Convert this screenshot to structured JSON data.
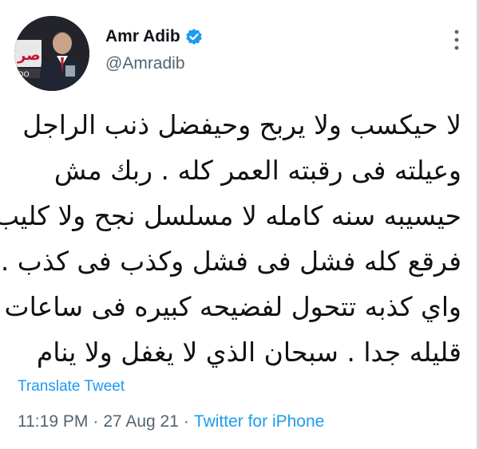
{
  "author": {
    "display_name": "Amr Adib",
    "handle": "@Amradib",
    "verified": true,
    "avatar_icon": "profile-photo",
    "avatar_logo_text": "صر",
    "avatar_caption_text": "IDO"
  },
  "tweet": {
    "lines": [
      "لا حيكسب ولا يربح وحيفضل ذنب الراجل",
      "وعيلته فى رقبته العمر كله . ربك مش",
      "حيسيبه سنه كامله لا مسلسل نجح ولا كليب",
      "فرقع كله فشل فى فشل وكذب فى كذب .",
      "واي كذبه تتحول لفضيحه كبيره فى ساعات",
      "قليله جدا . سبحان الذي لا يغفل ولا ينام"
    ],
    "translate_label": "Translate Tweet",
    "time": "11:19 PM",
    "separator": "·",
    "date": "27 Aug 21",
    "source": "Twitter for iPhone"
  },
  "colors": {
    "accent": "#1d9bf0",
    "text": "#0f1419",
    "secondary": "#536471"
  },
  "icons": {
    "verified": "verified-badge-icon",
    "more": "more-options-icon"
  }
}
